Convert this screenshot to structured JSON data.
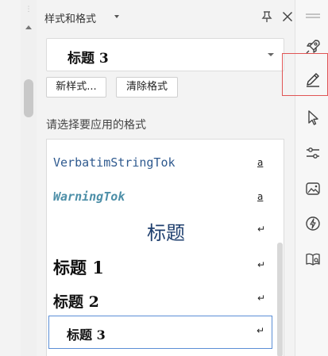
{
  "panel": {
    "title": "样式和格式",
    "current_style": "标题 3",
    "new_style_button": "新样式...",
    "clear_format_button": "清除格式",
    "section_label": "请选择要应用的格式"
  },
  "styles": [
    {
      "label": "VerbatimStringTok",
      "mark": "a"
    },
    {
      "label": "WarningTok",
      "mark": "a"
    },
    {
      "label": "标题",
      "mark": "↵"
    },
    {
      "label": "标题 1",
      "mark": "↵"
    },
    {
      "label": "标题 2",
      "mark": "↵"
    },
    {
      "label": "标题 3",
      "mark": "↵",
      "selected": true
    }
  ],
  "right_toolbar": [
    "rocket-icon",
    "pen-icon",
    "cursor-icon",
    "sliders-icon",
    "image-icon",
    "lightning-icon",
    "book-search-icon"
  ],
  "colors": {
    "highlight": "#e05555",
    "selected_border": "#5b8ed6",
    "code_blue": "#2f5a8f",
    "warning_teal": "#4d8fa8"
  }
}
